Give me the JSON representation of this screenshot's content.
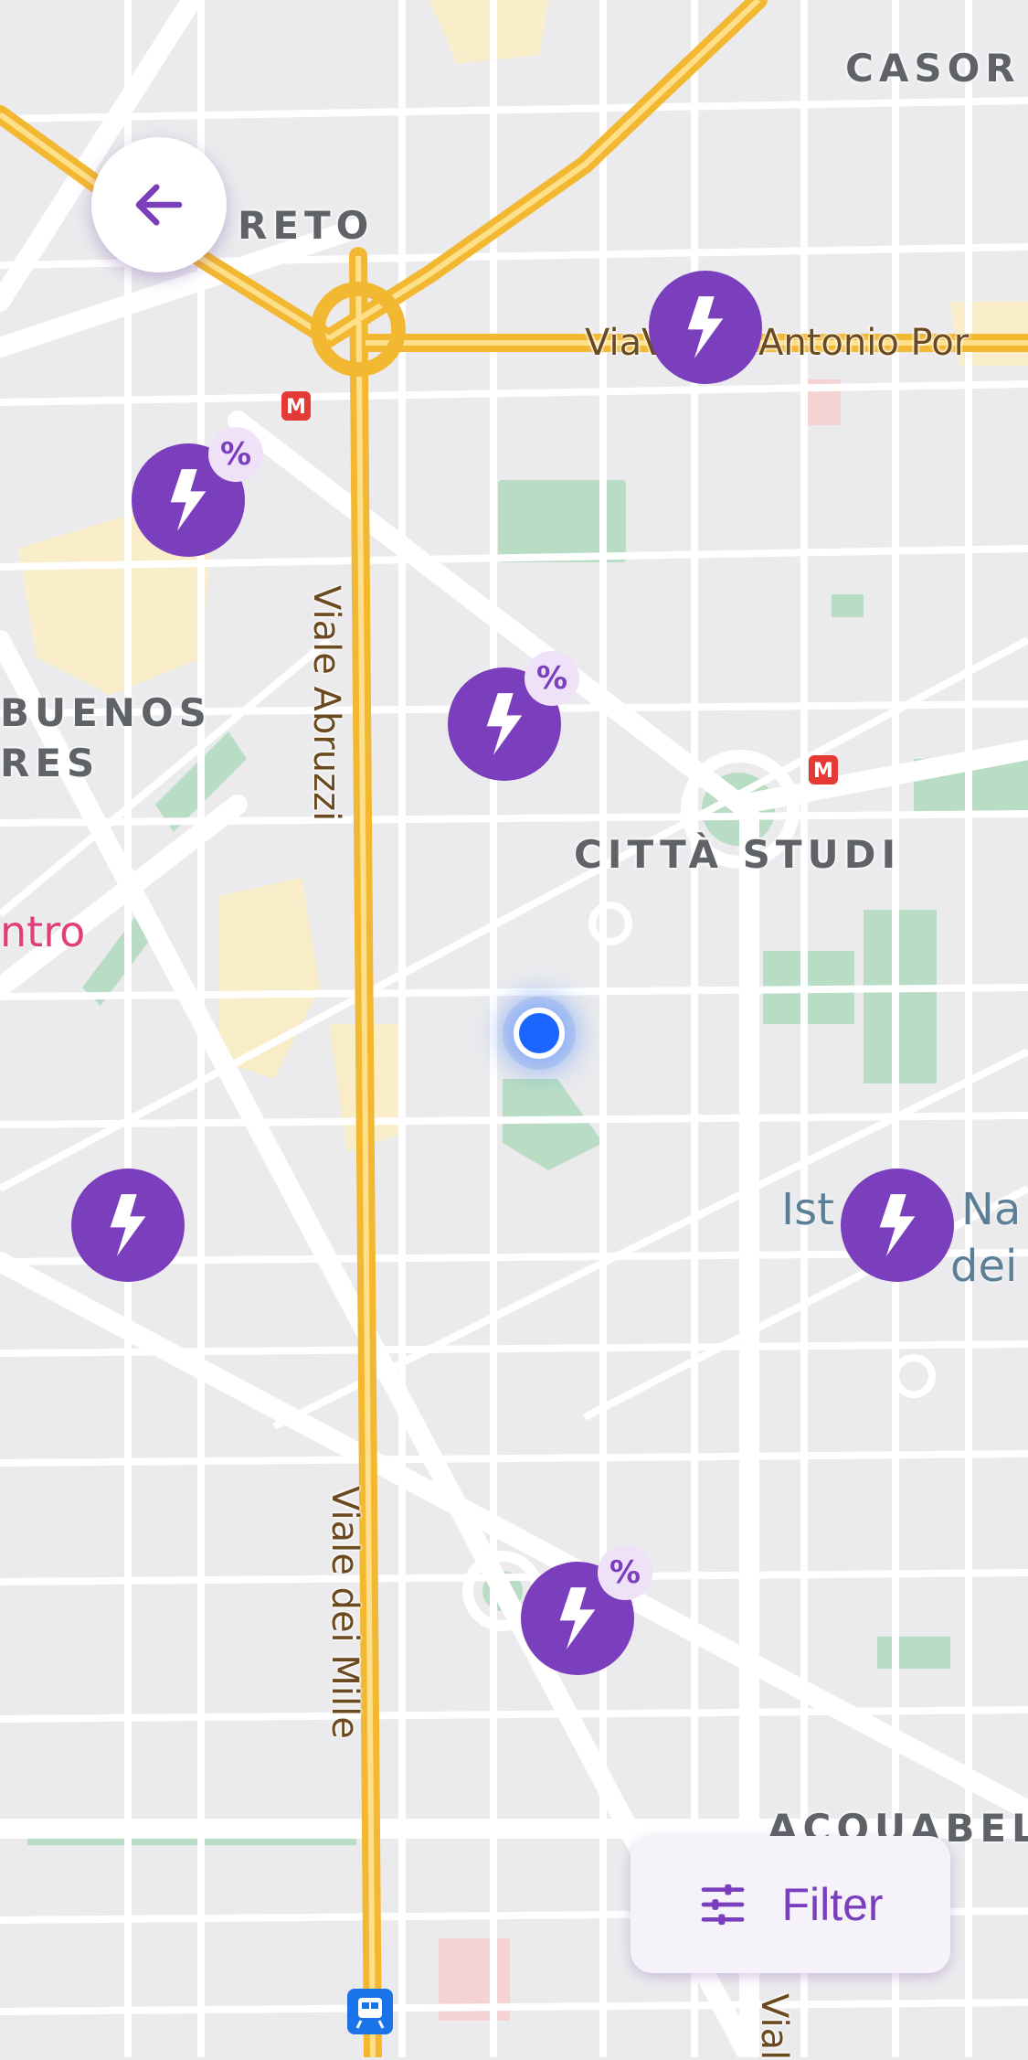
{
  "map": {
    "districts": [
      "RETO",
      "CASOR",
      "BUENOS",
      "RES",
      "CITTÀ STUDI",
      "ACQUABEL"
    ],
    "roads": [
      "Via",
      "Viale",
      "Antonio Por",
      "Viale Abruzzi",
      "Viale dei Mille",
      "Vial"
    ],
    "pois": [
      "Ist",
      "Na",
      "dei"
    ],
    "partial_labels": [
      "ntro"
    ]
  },
  "markers": [
    {
      "type": "charging-station",
      "icon": "lightning-bolt-icon",
      "badge": ""
    },
    {
      "type": "charging-station",
      "icon": "lightning-bolt-icon",
      "badge": "%"
    },
    {
      "type": "charging-station",
      "icon": "lightning-bolt-icon",
      "badge": "%"
    },
    {
      "type": "charging-station",
      "icon": "lightning-bolt-icon",
      "badge": ""
    },
    {
      "type": "charging-station",
      "icon": "lightning-bolt-icon",
      "badge": ""
    },
    {
      "type": "charging-station",
      "icon": "lightning-bolt-icon",
      "badge": "%"
    }
  ],
  "controls": {
    "back_icon": "arrow-left-icon",
    "filter_label": "Filter",
    "filter_icon": "sliders-icon"
  },
  "colors": {
    "accent": "#7b3fbe",
    "badge_bg": "#efe1f8",
    "location": "#1a66ff",
    "major_road": "#f5c04a",
    "park": "#b5dcc0",
    "map_bg": "#ebebed"
  }
}
